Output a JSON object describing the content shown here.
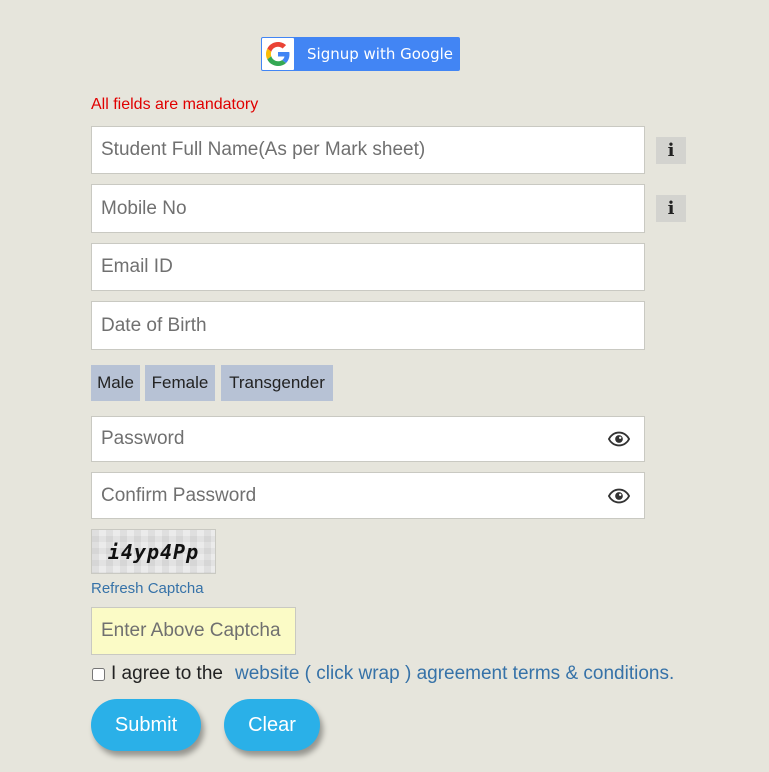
{
  "google": {
    "label": "Signup with Google",
    "icon": "google-g-icon"
  },
  "form": {
    "mandatory_note": "All fields are mandatory",
    "fields": {
      "full_name": {
        "placeholder": "Student Full Name(As per Mark sheet)",
        "value": ""
      },
      "mobile": {
        "placeholder": "Mobile No",
        "value": ""
      },
      "email": {
        "placeholder": "Email ID",
        "value": ""
      },
      "dob": {
        "placeholder": "Date of Birth",
        "value": ""
      },
      "password": {
        "placeholder": "Password",
        "value": ""
      },
      "confirm_password": {
        "placeholder": "Confirm Password",
        "value": ""
      }
    },
    "info_icon": "i",
    "gender_options": [
      "Male",
      "Female",
      "Transgender"
    ],
    "captcha": {
      "text": "i4yp4Pp",
      "refresh_label": "Refresh Captcha",
      "placeholder": "Enter Above Captcha",
      "value": ""
    },
    "agree": {
      "text": "I agree to the",
      "link_text": "website ( click wrap ) agreement terms & conditions.",
      "checked": false
    },
    "buttons": {
      "submit": "Submit",
      "clear": "Clear"
    }
  },
  "colors": {
    "background": "#e6e5dc",
    "mandatory": "#e00000",
    "link": "#3672a8",
    "button": "#2ab0e8",
    "google": "#4285f4",
    "gender_chip": "#b7c2d5",
    "captcha_input": "#fbfbc6"
  }
}
